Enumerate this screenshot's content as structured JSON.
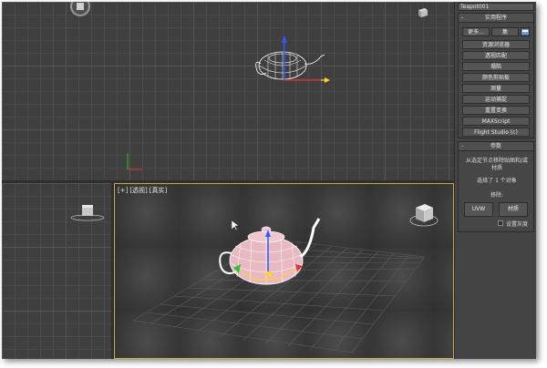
{
  "viewport_label": {
    "bracket_plus": "[+]",
    "view": "[透视]",
    "shading": "[真实]"
  },
  "panel": {
    "object_name": "Teapot001",
    "utilities": {
      "title": "实用程序",
      "toggle": "-",
      "more_label": "更多...",
      "sets_label": "集",
      "buttons": [
        "资源浏览器",
        "透视匹配",
        "塌陷",
        "颜色剪贴板",
        "测量",
        "运动捕捉",
        "重置变换",
        "MAXScript",
        "Flight Studio (c)"
      ]
    },
    "parameters": {
      "title": "参数",
      "toggle": "-",
      "description_line1": "从选定节点移除贴图和/或",
      "description_line2": "材质",
      "selected_text": "选择了 1 个对象",
      "remove_label": "移除:",
      "uvw_button": "UVW",
      "material_button": "材质",
      "set_real_label": "设置灰度"
    }
  },
  "colors": {
    "viewport_bg": "#3f3f3f",
    "active_border": "#c9a74a",
    "teapot_wire": "#ffffff",
    "teapot_fill": "#e9b9c2",
    "axis_x": "#e53232",
    "axis_y": "#2ac32a",
    "axis_z": "#2b5cff",
    "gizmo_yellow": "#ffd23a"
  }
}
